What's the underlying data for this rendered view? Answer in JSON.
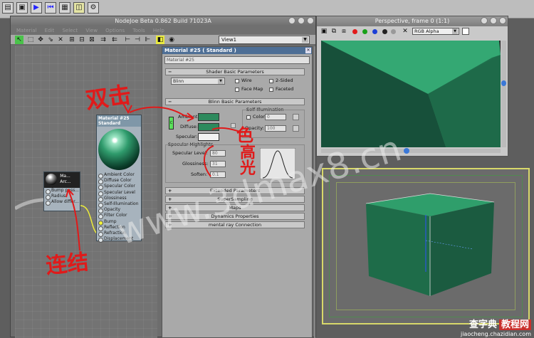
{
  "maxbar": {
    "icons": [
      "layer-icon",
      "layer-icon",
      "play-icon",
      "prev-icon",
      "grid-icon",
      "node-icon",
      "gear-icon"
    ]
  },
  "nodejoe": {
    "title": "NodeJoe Beta 0.862 Build 71023A",
    "menu": [
      "Material",
      "Edit",
      "Select",
      "View",
      "Options",
      "Tools",
      "Help"
    ],
    "view_select": "View1",
    "graph": {
      "material_node": {
        "title": "Material #25",
        "subtitle": "Standard",
        "slots": [
          "Ambient Color",
          "Diffuse Color",
          "Specular Color",
          "Specular Level",
          "Glossiness",
          "Self-Illumination",
          "Opacity",
          "Filter Color",
          "Bump",
          "Reflection",
          "Refraction",
          "Displacement"
        ]
      },
      "map_node": {
        "title": "Ma...",
        "subtitle": "Arc...",
        "slots": [
          "Bump pass...",
          "Radius:",
          "Allow differ..."
        ]
      }
    }
  },
  "material_panel": {
    "title": "Material #25  ( Standard )",
    "name_field": "Material #25",
    "shader_basic": {
      "title": "Shader Basic Parameters",
      "shader": "Blinn",
      "wire": "Wire",
      "two_sided": "2-Sided",
      "face_map": "Face Map",
      "faceted": "Faceted"
    },
    "blinn_basic": {
      "title": "Blinn Basic Parameters",
      "self_illum": "Self-Illumination",
      "color": "Color",
      "color_value": "0",
      "ambient": "Ambient:",
      "diffuse": "Diffuse:",
      "specular": "Specular:",
      "opacity": "Opacity:",
      "opacity_value": "100",
      "lock": "C",
      "highlights": "Specular Highlights",
      "specular_level": "Specular Level:",
      "specular_level_value": "80",
      "glossiness": "Glossiness:",
      "glossiness_value": "31",
      "soften": "Soften:",
      "soften_value": "0.1"
    },
    "rollouts": [
      "Extended Parameters",
      "SuperSampling",
      "Maps",
      "Dynamics Properties",
      "mental ray Connection"
    ],
    "colors": {
      "ambient": "#2d8a5d",
      "diffuse": "#2d8a5d",
      "specular": "#f2f2f2"
    }
  },
  "annotations": {
    "double_click": "双击",
    "color": "色",
    "highlight": "高光",
    "connect": "连结"
  },
  "perspective": {
    "title": "Perspective, frame 0 (1:1)",
    "channel": "RGB Alpha"
  },
  "watermark": {
    "text": "www.3dmax8.cn",
    "brand": "查字典",
    "brand_tag": "教程网",
    "brand_url": "jiaocheng.chazidian.com"
  }
}
